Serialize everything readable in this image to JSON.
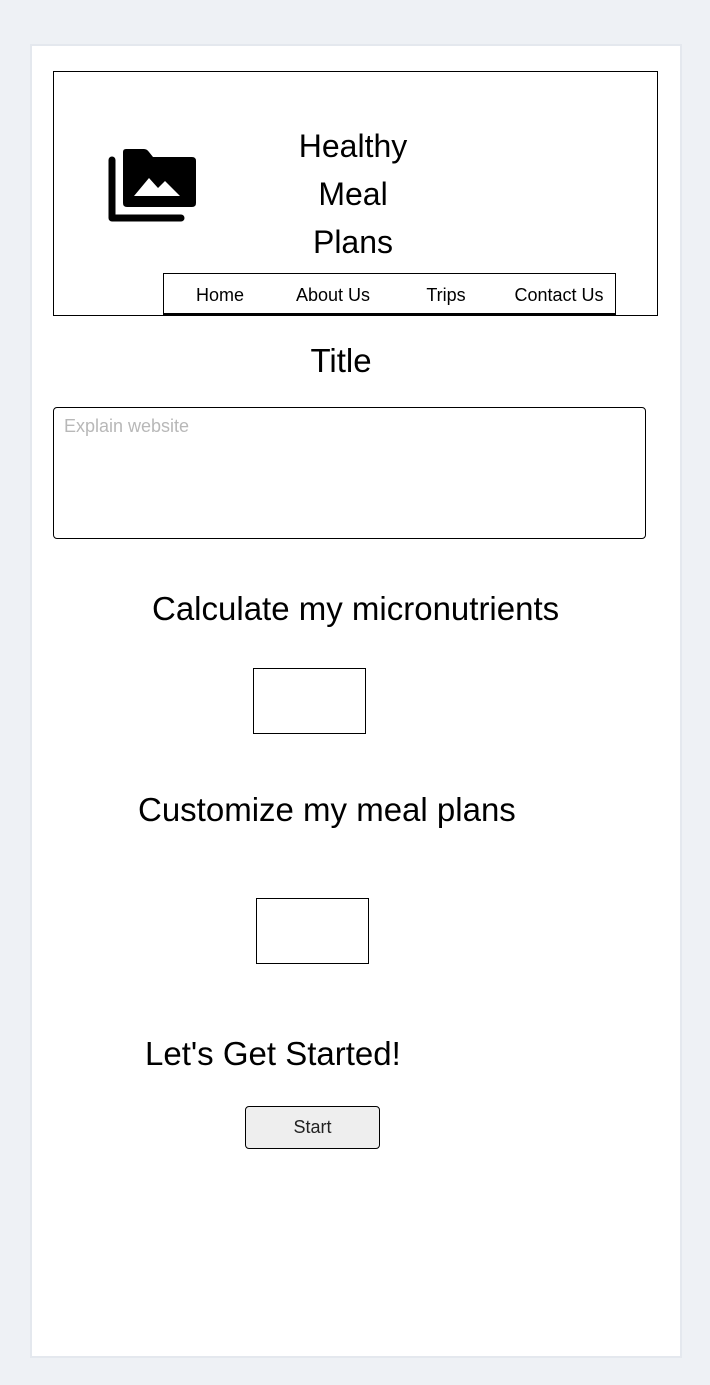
{
  "header": {
    "logo_icon": "photo-library-icon",
    "title_lines": [
      "Healthy",
      "Meal",
      "Plans"
    ]
  },
  "nav": {
    "items": [
      {
        "label": "Home"
      },
      {
        "label": "About Us"
      },
      {
        "label": "Trips"
      },
      {
        "label": "Contact Us"
      }
    ]
  },
  "main": {
    "title": "Title",
    "explain_placeholder": "Explain website",
    "explain_value": "",
    "micronutrients": {
      "heading": "Calculate my micronutrients",
      "input_value": ""
    },
    "meal_plans": {
      "heading": "Customize my meal plans",
      "input_value": ""
    },
    "get_started": {
      "heading": "Let's Get Started!",
      "button_label": "Start"
    }
  },
  "colors": {
    "background": "#eef1f5",
    "panel": "#ffffff",
    "border": "#000000",
    "button_fill": "#eeeeee",
    "placeholder": "#b8b8b8"
  }
}
